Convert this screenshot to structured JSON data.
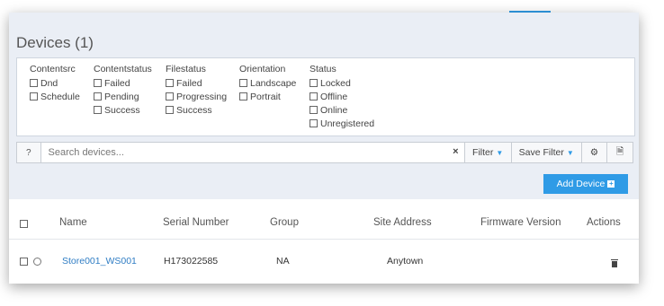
{
  "page": {
    "title": "Devices (1)"
  },
  "filters": [
    {
      "label": "Contentsrc",
      "options": [
        "Dnd",
        "Schedule"
      ]
    },
    {
      "label": "Contentstatus",
      "options": [
        "Failed",
        "Pending",
        "Success"
      ]
    },
    {
      "label": "Filestatus",
      "options": [
        "Failed",
        "Progressing",
        "Success"
      ]
    },
    {
      "label": "Orientation",
      "options": [
        "Landscape",
        "Portrait"
      ]
    },
    {
      "label": "Status",
      "options": [
        "Locked",
        "Offline",
        "Online",
        "Unregistered"
      ]
    }
  ],
  "toolbar": {
    "search_placeholder": "Search devices...",
    "help_icon": "?",
    "clear_icon": "×",
    "filter_label": "Filter",
    "save_filter_label": "Save Filter",
    "settings_icon": "⚙",
    "export_icon": "🗎"
  },
  "add_device": {
    "label": "Add Device"
  },
  "table": {
    "columns": [
      "Name",
      "Serial Number",
      "Group",
      "Site Address",
      "Firmware Version",
      "Actions"
    ],
    "rows": [
      {
        "name": "Store001_WS001",
        "serial": "H173022585",
        "group": "NA",
        "site": "Anytown",
        "firmware": ""
      }
    ]
  },
  "colors": {
    "accent": "#2f9be6",
    "link": "#2f7dc4",
    "header_bg": "#eaeef5"
  }
}
